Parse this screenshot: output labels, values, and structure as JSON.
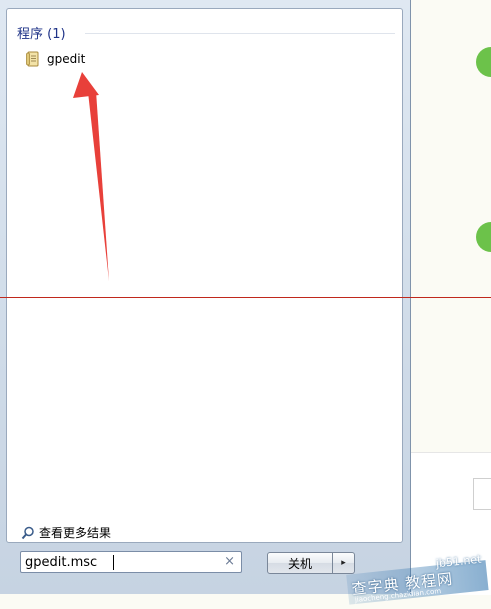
{
  "start_menu": {
    "group_header": "程序 (1)",
    "results": [
      {
        "label": "gpedit",
        "icon": "msc-document-icon"
      }
    ],
    "more_results_label": "查看更多结果",
    "search": {
      "value": "gpedit.msc",
      "clear_glyph": "×"
    },
    "shutdown": {
      "label": "关机",
      "arrow_glyph": "▸"
    }
  },
  "watermark": {
    "top_text": "jb51.net",
    "main_text": "查字典 教程网",
    "sub_text": "jiaocheng.chazidian.com"
  },
  "colors": {
    "annotation_arrow": "#e8403a",
    "annotation_line": "#c0281c",
    "header_blue": "#1e3287",
    "green_dot": "#6cc24a"
  }
}
